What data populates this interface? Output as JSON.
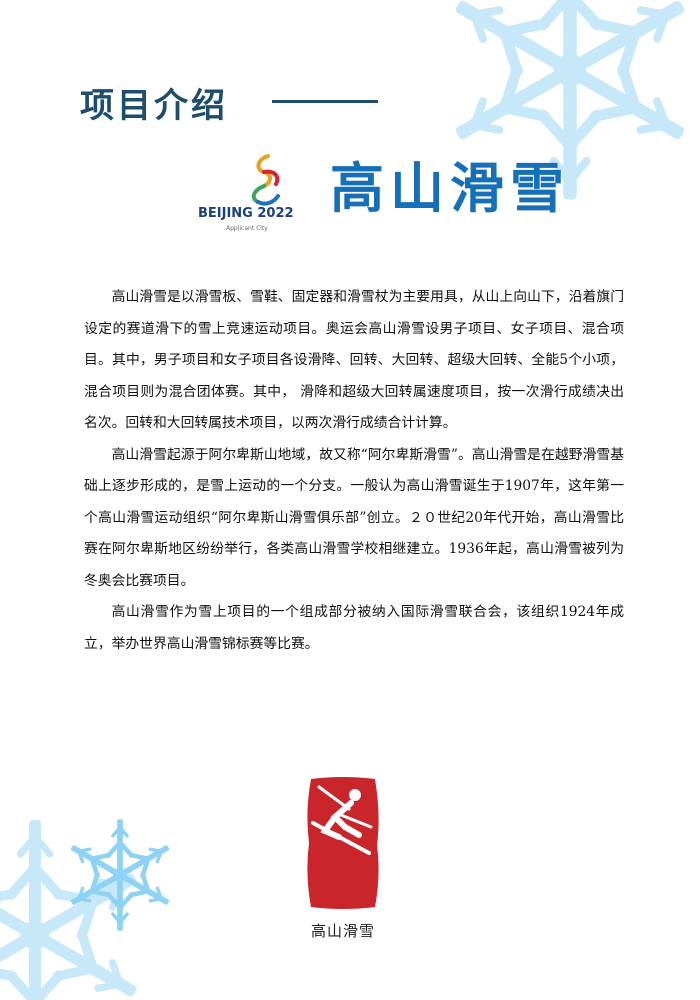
{
  "header": {
    "title": "项目介绍",
    "dash": "——"
  },
  "logo": {
    "wordmark": "BEIJING 2022",
    "subtitle": "Applicant City"
  },
  "main_title": "高山滑雪",
  "paragraphs": [
    "高山滑雪是以滑雪板、雪鞋、固定器和滑雪杖为主要用具，从山上向山下，沿着旗门设定的赛道滑下的雪上竞速运动项目。奥运会高山滑雪设男子项目、女子项目、混合项目。其中，男子项目和女子项目各设滑降、回转、大回转、超级大回转、全能5个小项，混合项目则为混合团体赛。其中， 滑降和超级大回转属速度项目，按一次滑行成绩决出名次。回转和大回转属技术项目，以两次滑行成绩合计计算。",
    "高山滑雪起源于阿尔卑斯山地域，故又称“阿尔卑斯滑雪”。高山滑雪是在越野滑雪基础上逐步形成的，是雪上运动的一个分支。一般认为高山滑雪诞生于1907年，这年第一个高山滑雪运动组织“阿尔卑斯山滑雪俱乐部”创立。２０世纪20年代开始，高山滑雪比赛在阿尔卑斯地区纷纷举行，各类高山滑雪学校相继建立。1936年起，高山滑雪被列为冬奥会比赛项目。",
    "高山滑雪作为雪上项目的一个组成部分被纳入国际滑雪联合会，该组织1924年成立，举办世界高山滑雪锦标赛等比赛。"
  ],
  "emblem": {
    "caption": "高山滑雪",
    "color": "#c8262b"
  },
  "colors": {
    "title": "#1d4e6e",
    "main_title": "#1570b8",
    "snowflake": "#c6e8f8"
  },
  "icons": [
    "snowflake-icon",
    "beijing-2022-emblem-icon",
    "alpine-skiing-pictogram-icon"
  ]
}
